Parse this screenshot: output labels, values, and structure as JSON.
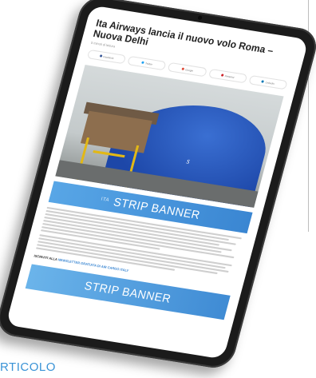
{
  "article": {
    "title": "Ita Airways lancia il nuovo volo Roma – Nuova Delhi",
    "meta": "5 minuti di lettura"
  },
  "shares": [
    {
      "label": "Facebook",
      "color": "#3b5998"
    },
    {
      "label": "Twitter",
      "color": "#1da1f2"
    },
    {
      "label": "Google",
      "color": "#dd4b39"
    },
    {
      "label": "Pinterest",
      "color": "#cb2027"
    },
    {
      "label": "LinkedIn",
      "color": "#0077b5"
    }
  ],
  "image": {
    "plane_text": "s"
  },
  "banner_top": {
    "small": "ITA",
    "label": "STRIP BANNER"
  },
  "subscribe": {
    "prefix": "ISCRIVITI ALLA",
    "link": "NEWSLETTER GRATUITA DI AIR CARGO ITALY"
  },
  "banner_bottom": {
    "label": "STRIP BANNER"
  },
  "caption": {
    "text": "RTICOLO"
  },
  "colors": {
    "accent": "#3a93d6",
    "banner": "#3a86d2"
  }
}
